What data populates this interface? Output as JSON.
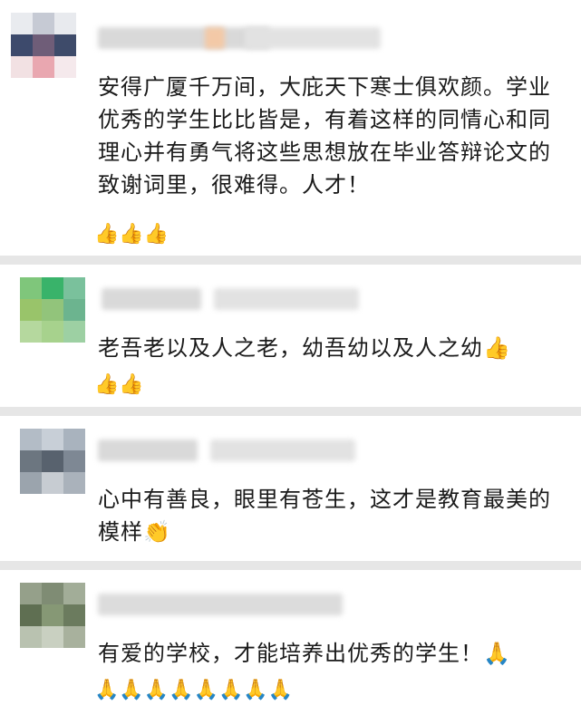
{
  "comments": [
    {
      "text": "安得广厦千万间，大庇天下寒士俱欢颜。学业优秀的学生比比皆是，有着这样的同情心和同理心并有勇气将这些思想放在毕业答辩论文的致谢词里，很难得。人才！",
      "reactions": "👍👍👍"
    },
    {
      "text": "老吾老以及人之老，幼吾幼以及人之幼👍",
      "reactions": "👍👍"
    },
    {
      "text": "心中有善良，眼里有苍生，这才是教育最美的模样👏",
      "reactions": ""
    },
    {
      "text": "有爱的学校，才能培养出优秀的学生！🙏",
      "reactions": "🙏🙏🙏🙏🙏🙏🙏🙏"
    }
  ],
  "colors": {
    "separator": "#e6e6e6",
    "text": "#1a1a1a",
    "blurred_name": "#d9d9d9"
  },
  "icons": {
    "thumbs_up": "thumbs-up-icon",
    "clap": "clap-icon",
    "pray": "pray-icon"
  }
}
